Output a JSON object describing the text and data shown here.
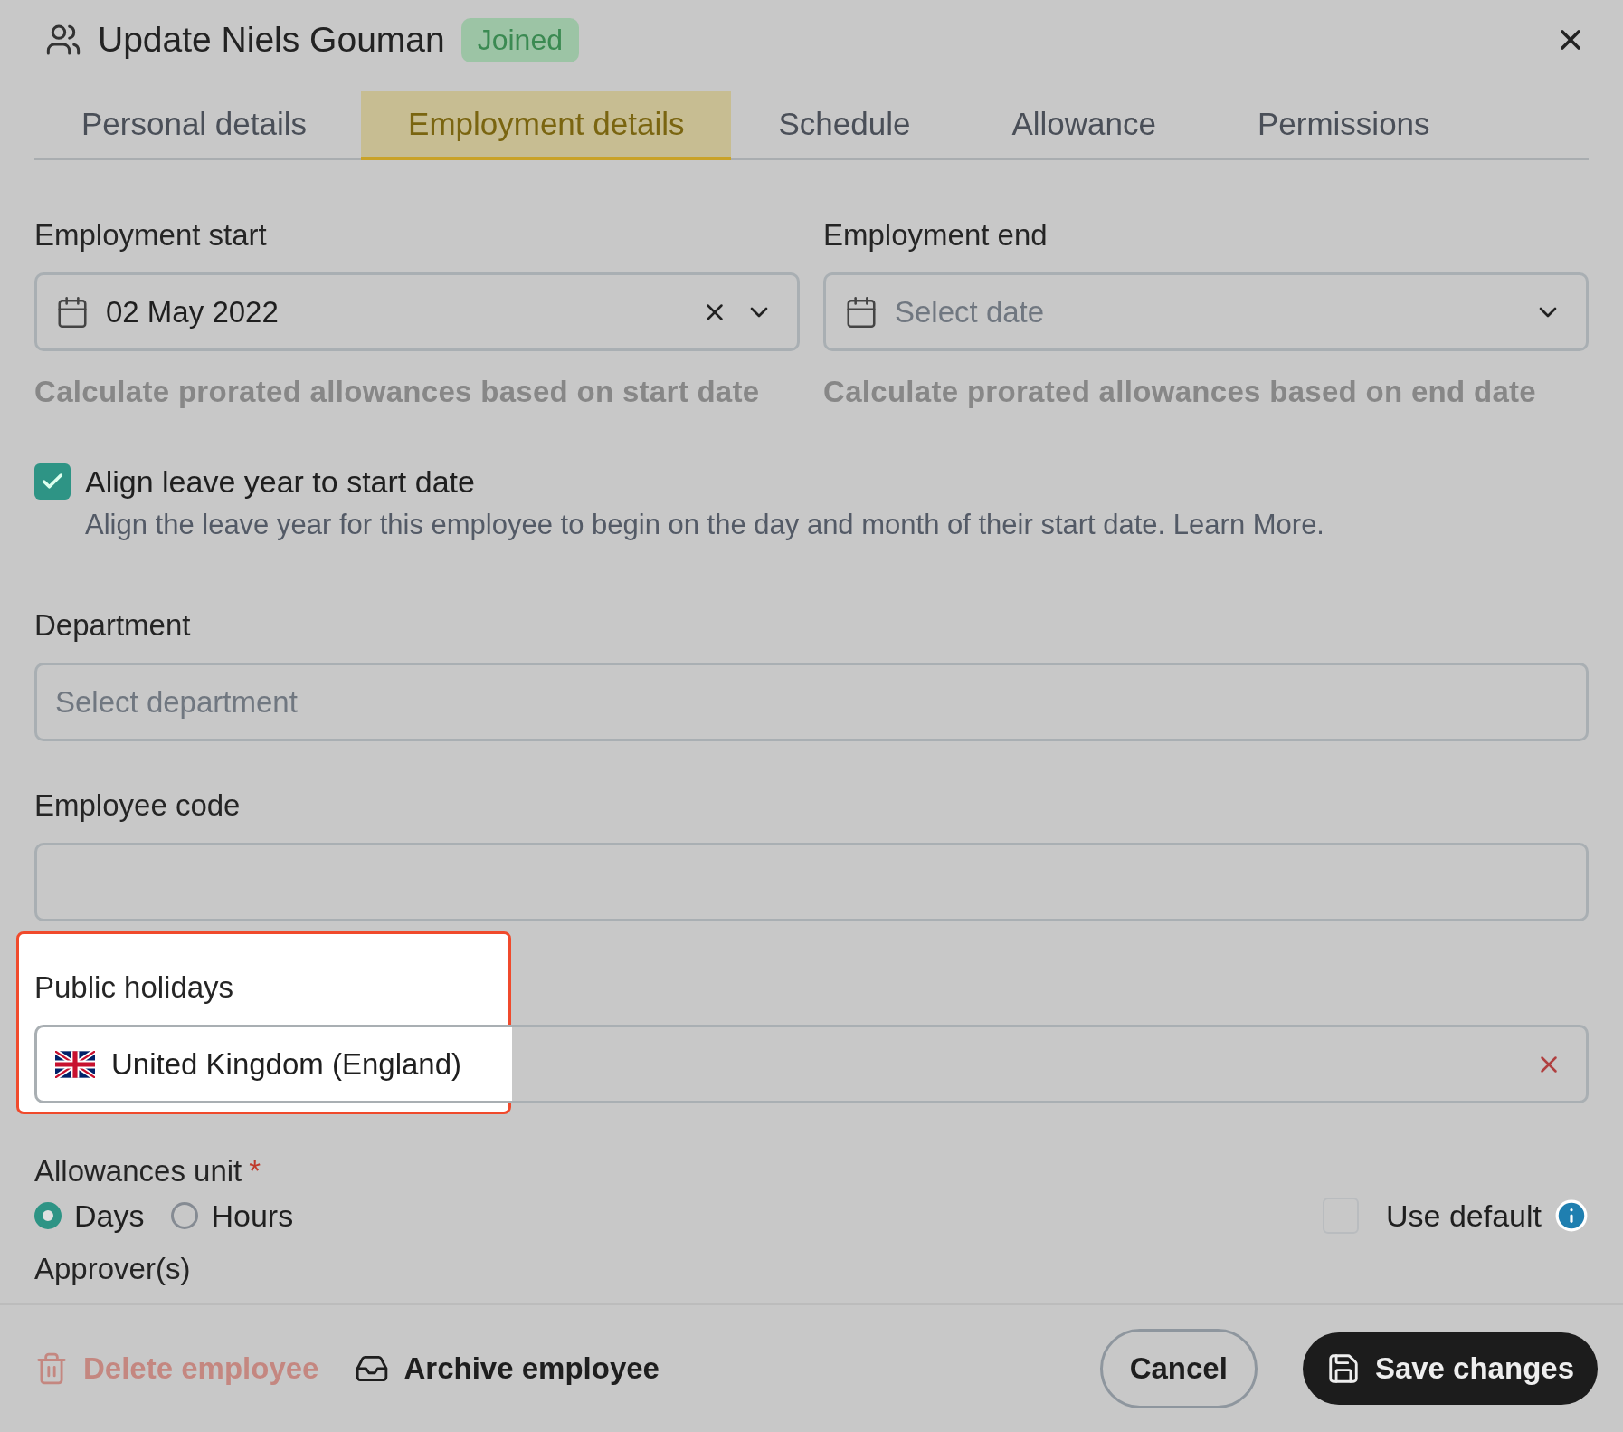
{
  "dialog": {
    "title": "Update Niels Gouman",
    "status_badge": "Joined"
  },
  "tabs": [
    {
      "label": "Personal details",
      "selected": false
    },
    {
      "label": "Employment details",
      "selected": true
    },
    {
      "label": "Schedule",
      "selected": false
    },
    {
      "label": "Allowance",
      "selected": false
    },
    {
      "label": "Permissions",
      "selected": false
    }
  ],
  "employment_start": {
    "label": "Employment start",
    "value": "02 May 2022",
    "hint": "Calculate prorated allowances based on start date"
  },
  "employment_end": {
    "label": "Employment end",
    "placeholder": "Select date",
    "hint": "Calculate prorated allowances based on end date"
  },
  "align_leave_year": {
    "label": "Align leave year to start date",
    "checked": true,
    "description": "Align the leave year for this employee to begin on the day and month of their start date. Learn More."
  },
  "department": {
    "label": "Department",
    "placeholder": "Select department"
  },
  "employee_code": {
    "label": "Employee code"
  },
  "public_holidays": {
    "label": "Public holidays",
    "value": "United Kingdom (England)",
    "highlighted": true
  },
  "allowances_unit": {
    "label": "Allowances unit",
    "required_mark": "*",
    "options": [
      {
        "label": "Days",
        "selected": true
      },
      {
        "label": "Hours",
        "selected": false
      }
    ],
    "use_default": {
      "label": "Use default",
      "checked": false
    }
  },
  "approvers": {
    "label": "Approver(s)"
  },
  "footer": {
    "buttons": [
      {
        "kind": "delete",
        "label": "Delete employee",
        "disabled": true
      },
      {
        "kind": "archive",
        "label": "Archive employee",
        "disabled": false
      },
      {
        "kind": "cancel",
        "label": "Cancel",
        "disabled": false
      },
      {
        "kind": "save",
        "label": "Save changes",
        "disabled": false
      }
    ]
  }
}
